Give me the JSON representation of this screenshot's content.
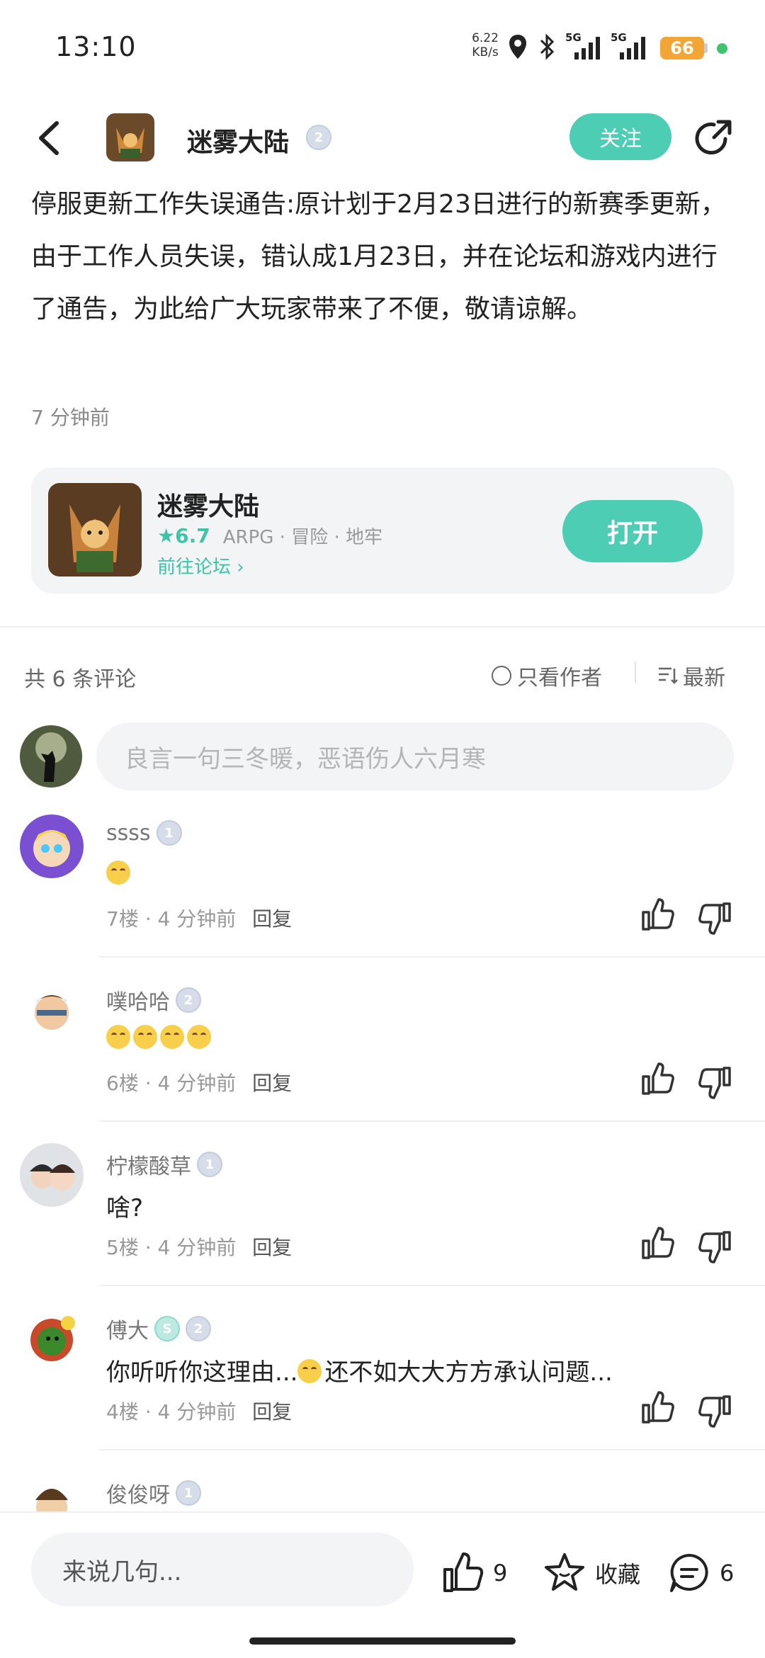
{
  "status_bar": {
    "time": "13:10",
    "net_speed_value": "6.22",
    "net_speed_unit": "KB/s",
    "signal_1": "5G",
    "signal_2": "5G",
    "battery": "66"
  },
  "header": {
    "author_name": "迷雾大陆",
    "author_level": "2",
    "follow_label": "关注"
  },
  "post": {
    "text": "停服更新工作失误通告:原计划于2月23日进行的新赛季更新，由于工作人员失误，错认成1月23日，并在论坛和游戏内进行了通告，为此给广大玩家带来了不便，敬请谅解。",
    "time": "7 分钟前"
  },
  "game_card": {
    "title": "迷雾大陆",
    "rating": "6.7",
    "tags": "ARPG · 冒险 · 地牢",
    "forum_link": "前往论坛",
    "open_label": "打开"
  },
  "comments_header": {
    "count_label": "共 6 条评论",
    "only_author_label": "只看作者",
    "sort_label": "最新"
  },
  "comment_input": {
    "placeholder": "良言一句三冬暖，恶语伤人六月寒"
  },
  "comments": [
    {
      "name": "ssss",
      "level": "1",
      "body": "",
      "emoji_count": 1,
      "floor": "7楼",
      "time": "4 分钟前",
      "reply": "回复"
    },
    {
      "name": "噗哈哈",
      "level": "2",
      "body": "",
      "emoji_count": 4,
      "floor": "6楼",
      "time": "4 分钟前",
      "reply": "回复"
    },
    {
      "name": "柠檬酸草",
      "level": "1",
      "body": "啥?",
      "emoji_count": 0,
      "floor": "5楼",
      "time": "4 分钟前",
      "reply": "回复"
    },
    {
      "name": "傅大",
      "level": "2",
      "body_before": "你听听你这理由...",
      "body_after": "还不如大大方方承认问题...",
      "floor": "4楼",
      "time": "4 分钟前",
      "reply": "回复"
    },
    {
      "name": "俊俊呀",
      "level": "1"
    }
  ],
  "bottom_bar": {
    "input_placeholder": "来说几句...",
    "like_count": "9",
    "favorite_label": "收藏",
    "comment_count": "6"
  },
  "colors": {
    "accent": "#4ccdb4",
    "battery": "#f2a636"
  }
}
